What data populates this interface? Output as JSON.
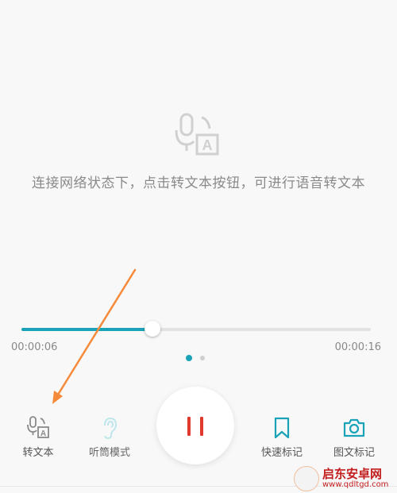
{
  "hint": {
    "text": "连接网络状态下，点击转文本按钮，可进行语音转文本"
  },
  "player": {
    "elapsed": "00:00:06",
    "total": "00:00:16",
    "progress_fraction": 0.375,
    "page_indicator": {
      "count": 2,
      "active": 1
    },
    "state": "playing"
  },
  "toolbar": {
    "transcribe": {
      "label": "转文本",
      "icon": "voice-to-text-icon"
    },
    "earpiece": {
      "label": "听筒模式",
      "icon": "ear-icon"
    },
    "play_pause": {
      "icon": "pause-icon"
    },
    "quick_mark": {
      "label": "快速标记",
      "icon": "bookmark-icon"
    },
    "photo_mark": {
      "label": "图文标记",
      "icon": "camera-icon"
    }
  },
  "watermark": {
    "name": "启东安卓网",
    "url": "www.qdltgd.com"
  },
  "colors": {
    "accent": "#1aa3b8",
    "pause": "#e03a2f",
    "annotation_arrow": "#f58a3a",
    "watermark": "#c21d1d"
  }
}
